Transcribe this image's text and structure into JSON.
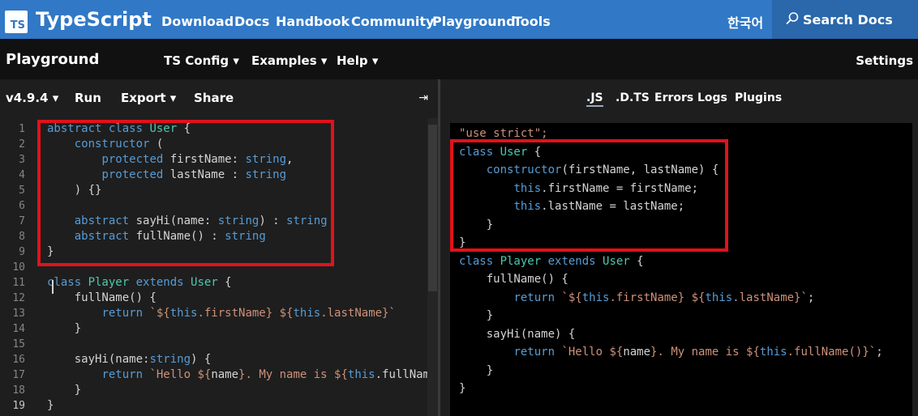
{
  "topnav": {
    "logo_text": "TS",
    "brand": "TypeScript",
    "links": [
      "Download",
      "Docs",
      "Handbook",
      "Community",
      "Playground",
      "Tools"
    ],
    "language": "한국어",
    "search_label": "Search Docs"
  },
  "playground_bar": {
    "title": "Playground",
    "menus": [
      "TS Config",
      "Examples",
      "Help"
    ],
    "settings": "Settings"
  },
  "editor_toolbar": {
    "version": "v4.9.4",
    "run": "Run",
    "export": "Export",
    "share": "Share",
    "collapse_icon": "⇥"
  },
  "output_tabs": [
    ".JS",
    ".D.TS",
    "Errors",
    "Logs",
    "Plugins"
  ],
  "output_tabs_active": ".JS",
  "editor": {
    "active_line": 19,
    "lines": [
      [
        [
          "abstract class ",
          "kw"
        ],
        [
          "User",
          "ty"
        ],
        [
          " {",
          "nm"
        ]
      ],
      [
        [
          "    ",
          "nm"
        ],
        [
          "constructor",
          "kw"
        ],
        [
          " (",
          "nm"
        ]
      ],
      [
        [
          "        ",
          "nm"
        ],
        [
          "protected",
          "kw"
        ],
        [
          " firstName: ",
          "nm"
        ],
        [
          "string",
          "kw"
        ],
        [
          ",",
          "nm"
        ]
      ],
      [
        [
          "        ",
          "nm"
        ],
        [
          "protected",
          "kw"
        ],
        [
          " lastName : ",
          "nm"
        ],
        [
          "string",
          "kw"
        ]
      ],
      [
        [
          "    ) {}",
          "nm"
        ]
      ],
      [
        [
          "",
          "nm"
        ]
      ],
      [
        [
          "    ",
          "nm"
        ],
        [
          "abstract",
          "kw"
        ],
        [
          " sayHi(name: ",
          "nm"
        ],
        [
          "string",
          "kw"
        ],
        [
          ") : ",
          "nm"
        ],
        [
          "string",
          "kw"
        ]
      ],
      [
        [
          "    ",
          "nm"
        ],
        [
          "abstract",
          "kw"
        ],
        [
          " fullName() : ",
          "nm"
        ],
        [
          "string",
          "kw"
        ]
      ],
      [
        [
          "}",
          "nm"
        ]
      ],
      [
        [
          "",
          "nm"
        ]
      ],
      [
        [
          "class ",
          "kw"
        ],
        [
          "Player",
          "ty"
        ],
        [
          " extends ",
          "kw"
        ],
        [
          "User",
          "ty"
        ],
        [
          " {",
          "nm"
        ]
      ],
      [
        [
          "    fullName() {",
          "nm"
        ]
      ],
      [
        [
          "        ",
          "nm"
        ],
        [
          "return",
          "kw"
        ],
        [
          " `${",
          "st"
        ],
        [
          "this",
          "kw"
        ],
        [
          ".firstName} ${",
          "st"
        ],
        [
          "this",
          "kw"
        ],
        [
          ".lastName}`",
          "st"
        ]
      ],
      [
        [
          "    }",
          "nm"
        ]
      ],
      [
        [
          "",
          "nm"
        ]
      ],
      [
        [
          "    sayHi(name:",
          "nm"
        ],
        [
          "string",
          "kw"
        ],
        [
          ") {",
          "nm"
        ]
      ],
      [
        [
          "        ",
          "nm"
        ],
        [
          "return",
          "kw"
        ],
        [
          " `Hello ${",
          "st"
        ],
        [
          "name",
          "nm"
        ],
        [
          "}. My name is ${",
          "st"
        ],
        [
          "this",
          "kw"
        ],
        [
          ".fullName()",
          "nm"
        ]
      ],
      [
        [
          "    }",
          "nm"
        ]
      ],
      [
        [
          "}",
          "nm"
        ]
      ]
    ]
  },
  "output": {
    "lines": [
      [
        [
          "\"use strict\";",
          "st"
        ]
      ],
      [
        [
          "class ",
          "kw"
        ],
        [
          "User",
          "ty"
        ],
        [
          " {",
          "nm"
        ]
      ],
      [
        [
          "    ",
          "nm"
        ],
        [
          "constructor",
          "kw"
        ],
        [
          "(firstName, lastName) {",
          "nm"
        ]
      ],
      [
        [
          "        ",
          "nm"
        ],
        [
          "this",
          "kw"
        ],
        [
          ".firstName = firstName;",
          "nm"
        ]
      ],
      [
        [
          "        ",
          "nm"
        ],
        [
          "this",
          "kw"
        ],
        [
          ".lastName = lastName;",
          "nm"
        ]
      ],
      [
        [
          "    }",
          "nm"
        ]
      ],
      [
        [
          "}",
          "nm"
        ]
      ],
      [
        [
          "class ",
          "kw"
        ],
        [
          "Player",
          "ty"
        ],
        [
          " extends ",
          "kw"
        ],
        [
          "User",
          "ty"
        ],
        [
          " {",
          "nm"
        ]
      ],
      [
        [
          "    fullName() {",
          "nm"
        ]
      ],
      [
        [
          "        ",
          "nm"
        ],
        [
          "return",
          "kw"
        ],
        [
          " `${",
          "st"
        ],
        [
          "this",
          "kw"
        ],
        [
          ".firstName} ${",
          "st"
        ],
        [
          "this",
          "kw"
        ],
        [
          ".lastName}`",
          "st"
        ],
        [
          ";",
          "nm"
        ]
      ],
      [
        [
          "    }",
          "nm"
        ]
      ],
      [
        [
          "    sayHi(name) {",
          "nm"
        ]
      ],
      [
        [
          "        ",
          "nm"
        ],
        [
          "return",
          "kw"
        ],
        [
          " `Hello ${",
          "st"
        ],
        [
          "name",
          "nm"
        ],
        [
          "}. My name is ${",
          "st"
        ],
        [
          "this",
          "kw"
        ],
        [
          ".fullName()}`",
          "st"
        ],
        [
          ";",
          "nm"
        ]
      ],
      [
        [
          "    }",
          "nm"
        ]
      ],
      [
        [
          "}",
          "nm"
        ]
      ]
    ]
  },
  "colors": {
    "nav_blue": "#3178c6",
    "highlight_red": "#e0121b",
    "keyword": "#569cd6",
    "type": "#4ec9b0",
    "string": "#ce9178"
  }
}
